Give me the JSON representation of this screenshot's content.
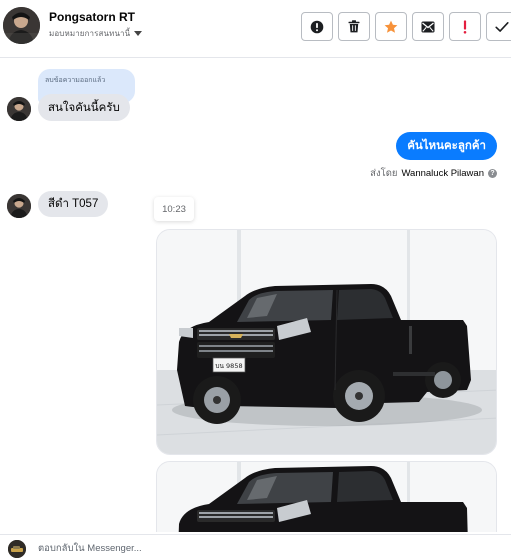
{
  "header": {
    "contact_name": "Pongsatorn RT",
    "assign_label": "มอบหมายการสนทนานี้",
    "actions": [
      {
        "icon": "alert-circle-icon",
        "color": "#1c1e21"
      },
      {
        "icon": "trash-icon",
        "color": "#1c1e21"
      },
      {
        "icon": "star-icon",
        "color": "#f7923a"
      },
      {
        "icon": "mark-unread-icon",
        "color": "#1c1e21"
      },
      {
        "icon": "exclamation-icon",
        "color": "#e41e3f"
      },
      {
        "icon": "checkmark-icon",
        "color": "#1c1e21"
      }
    ]
  },
  "thread": {
    "deleted_notice": "ลบข้อความออกแล้ว",
    "msg1": "สนใจคันนี้ครับ",
    "reply": "คันไหนคะลูกค้า",
    "sent_by_label": "ส่งโดย",
    "sent_by_name": "Wannaluck Pilawan",
    "msg2": "สีดำ T057",
    "timestamp": "10:23",
    "plate_text": "บน 9858"
  },
  "composer": {
    "placeholder": "ตอบกลับใน Messenger..."
  },
  "colors": {
    "accent_blue": "#0a7cff",
    "incoming_bubble": "#e4e6eb",
    "quote_bubble": "#dbe8fb",
    "star_orange": "#f7923a",
    "alert_red": "#e41e3f"
  }
}
